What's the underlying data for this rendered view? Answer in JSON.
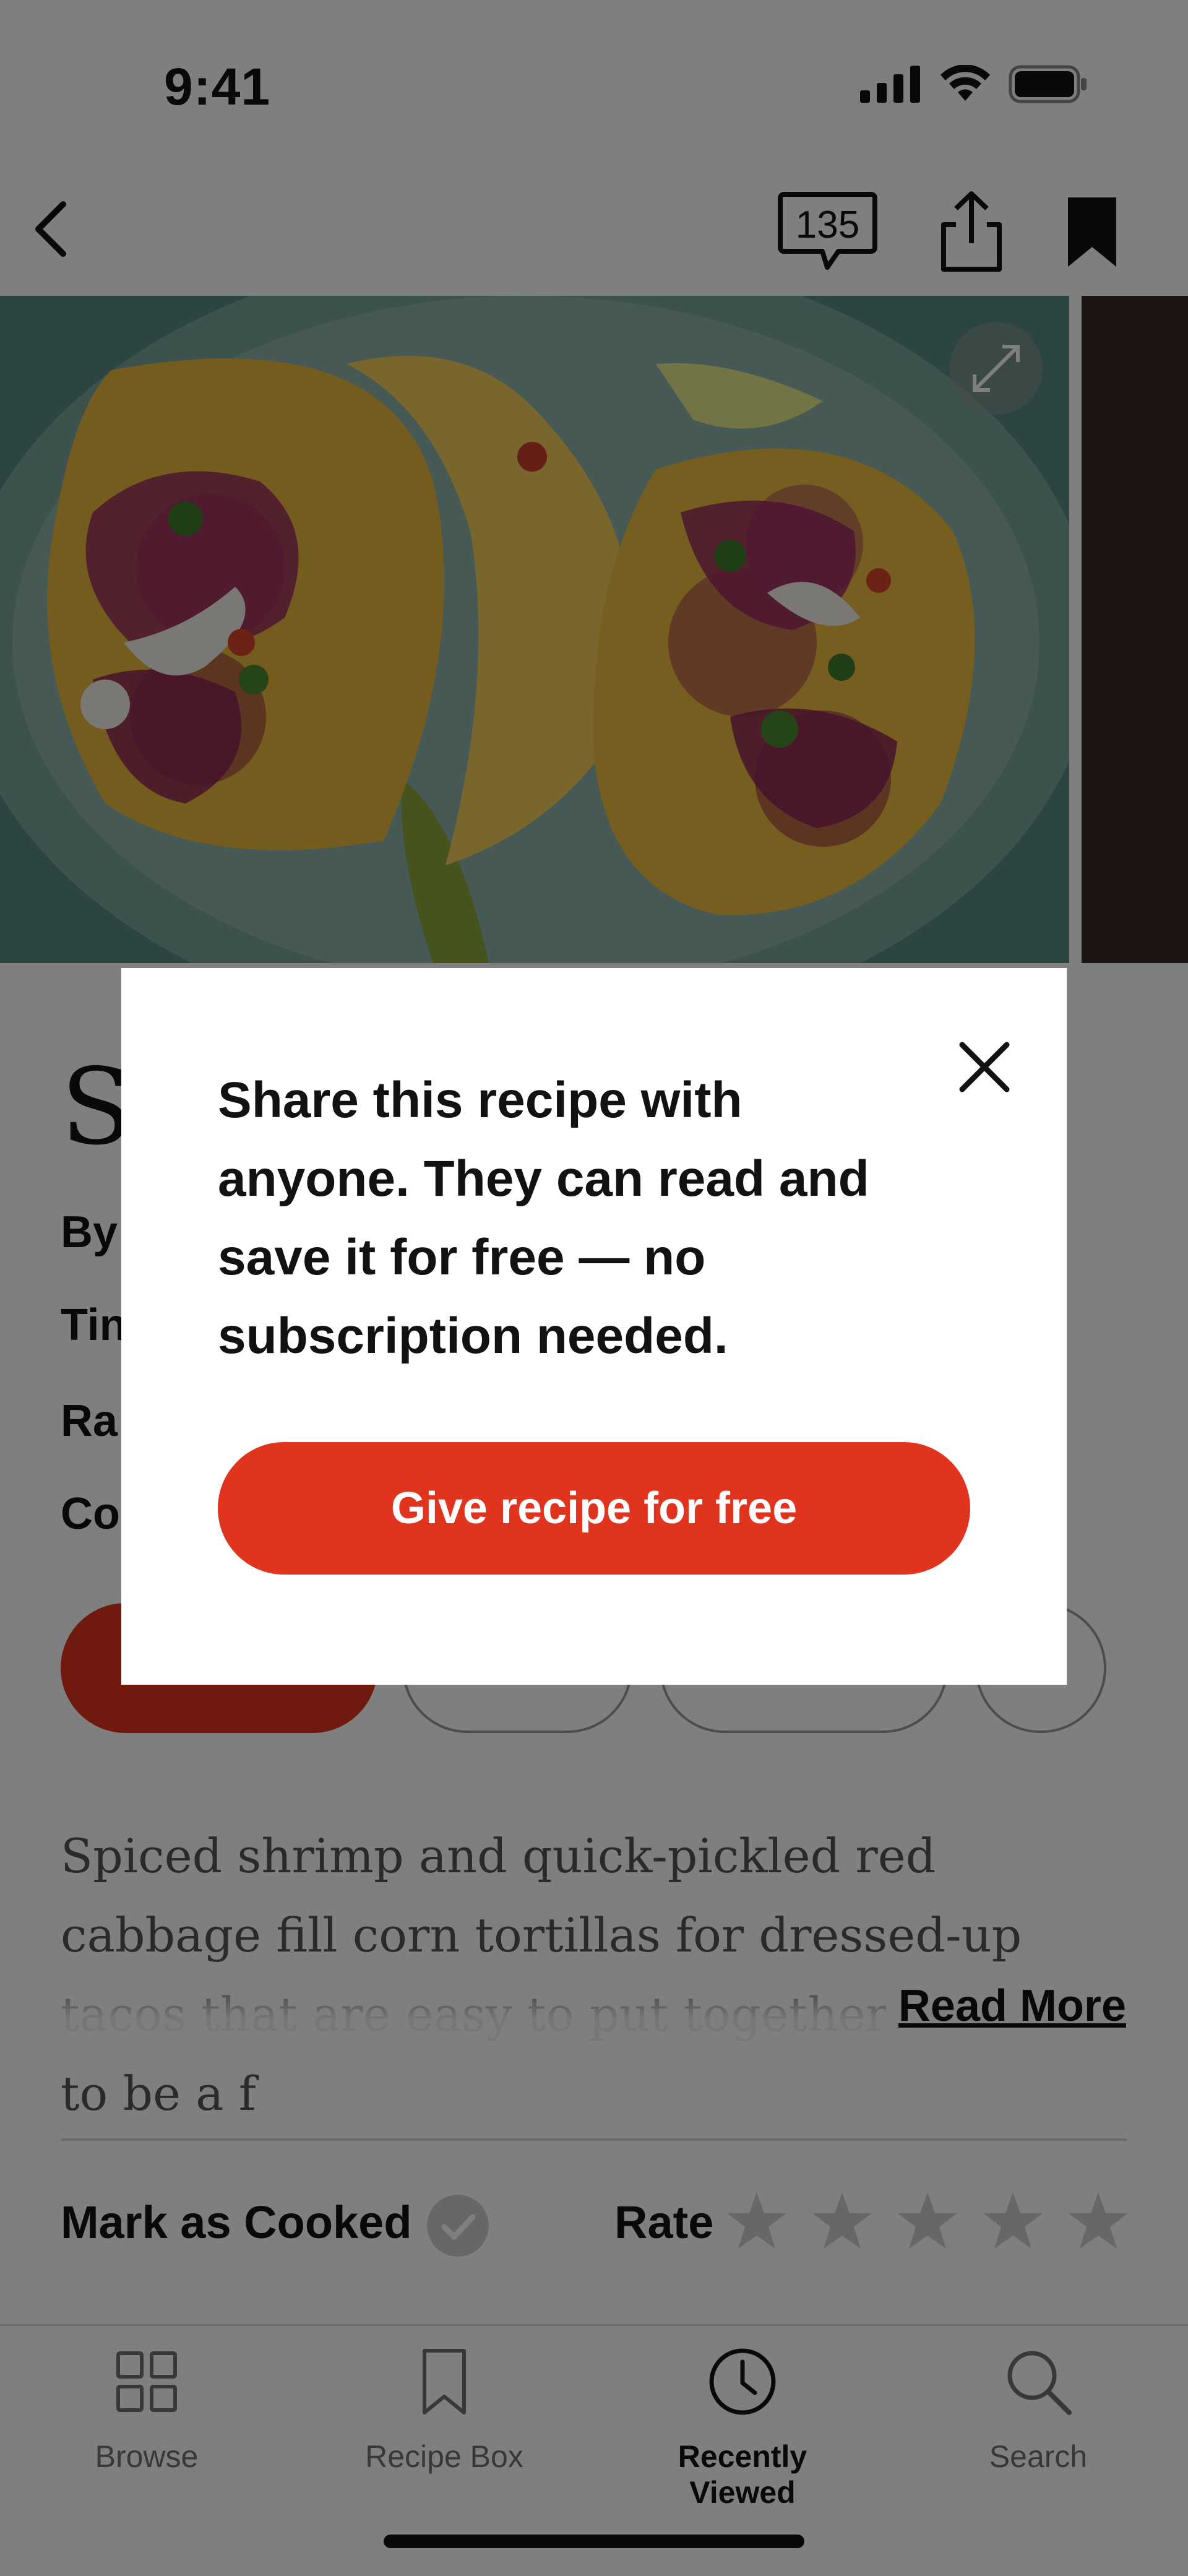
{
  "status_bar": {
    "time": "9:41"
  },
  "nav": {
    "comment_count": "135"
  },
  "recipe": {
    "title_initial": "S",
    "meta_partials": [
      "By",
      "Tin",
      "Ra",
      "Co"
    ],
    "description": "Spiced shrimp and quick-pickled red cabbage fill corn tortillas for dressed-up tacos that are easy to put together and sure to be a f",
    "read_more": "Read More",
    "mark_as_cooked": "Mark as Cooked",
    "rate_label": "Rate",
    "rating": 0,
    "rating_max": 5
  },
  "tabs": [
    {
      "label": "Browse",
      "icon": "grid-icon",
      "active": false
    },
    {
      "label": "Recipe Box",
      "icon": "bookmark-outline-icon",
      "active": false
    },
    {
      "label": "Recently Viewed",
      "icon": "clock-icon",
      "active": true
    },
    {
      "label": "Search",
      "icon": "search-icon",
      "active": false
    }
  ],
  "modal": {
    "message": "Share this recipe with anyone. They can read and save it for free — no subscription needed.",
    "button_label": "Give recipe for free"
  },
  "colors": {
    "accent": "#e0341e",
    "scrim": "rgba(0,0,0,0.5)"
  }
}
